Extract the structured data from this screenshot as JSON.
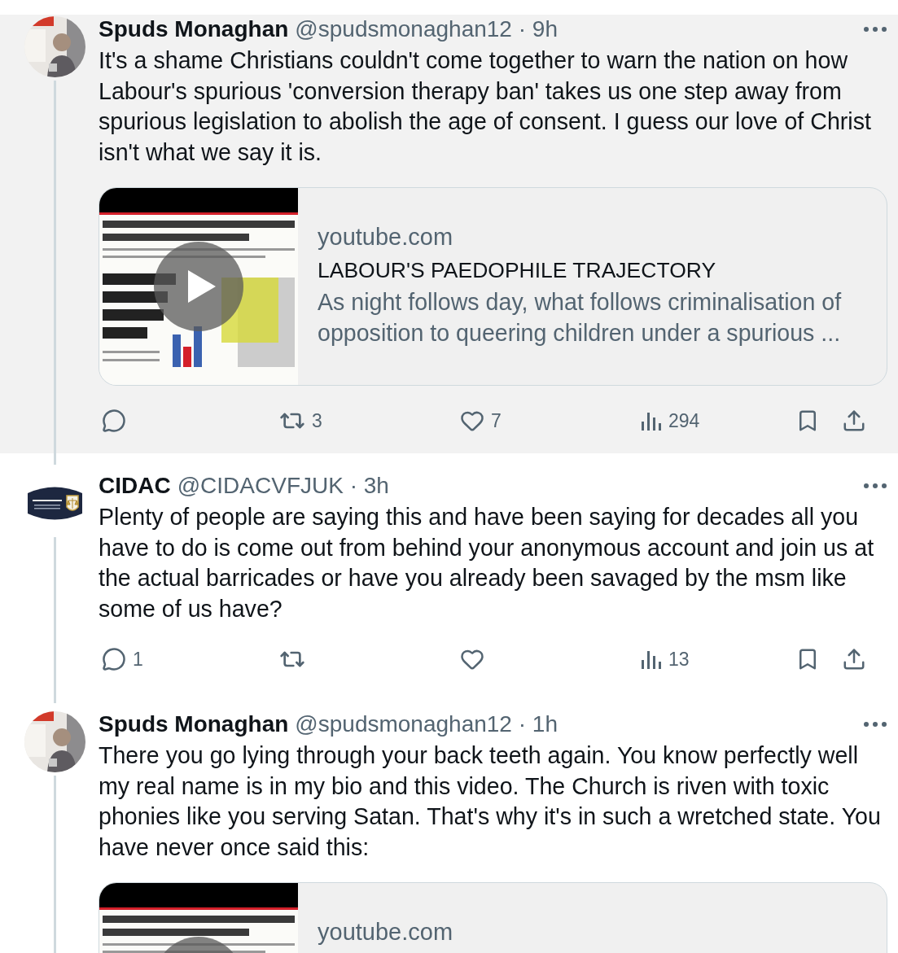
{
  "tweets": [
    {
      "author": "Spuds Monaghan",
      "meta": "@spudsmonaghan12 · 9h",
      "highlighted": true,
      "text": "It's a shame Christians couldn't come together to warn the nation on how Labour's spurious 'conversion therapy ban' takes us one step away from spurious legislation to abolish the age of consent. I guess our love of Christ isn't what we say it is.",
      "card": {
        "video": true,
        "domain": "youtube.com",
        "title": "LABOUR'S PAEDOPHILE TRAJECTORY",
        "description": "As night follows day, what follows criminalisation of opposition to queering children under a spurious ..."
      },
      "actions": [
        {
          "kind": "reply"
        },
        {
          "kind": "repost",
          "count": "3"
        },
        {
          "kind": "like",
          "count": "7"
        },
        {
          "kind": "views",
          "count": "294"
        },
        {
          "kind": "bookmark"
        },
        {
          "kind": "share"
        }
      ]
    },
    {
      "author": "CIDAC",
      "meta": "@CIDACVFJUK · 3h",
      "avatar": {
        "kind": "logo"
      },
      "highlighted": false,
      "text": "Plenty of people are saying this and have been saying for decades all you have to do is come out from behind your anonymous account and join us at the actual barricades or have you already been savaged by the msm like some of us have?",
      "actions": [
        {
          "kind": "reply",
          "count": "1"
        },
        {
          "kind": "repost"
        },
        {
          "kind": "like"
        },
        {
          "kind": "views",
          "count": "13"
        },
        {
          "kind": "bookmark"
        },
        {
          "kind": "share"
        }
      ]
    },
    {
      "author": "Spuds Monaghan",
      "meta": "@spudsmonaghan12 · 1h",
      "highlighted": false,
      "text": "There you go lying through your back teeth again. You know perfectly well my real name is in my bio and this video. The Church is riven with toxic phonies like you serving Satan. That's why it's in such a wretched state. You have never once said this:",
      "card": {
        "video": true,
        "domain": "youtube.com"
      }
    }
  ]
}
